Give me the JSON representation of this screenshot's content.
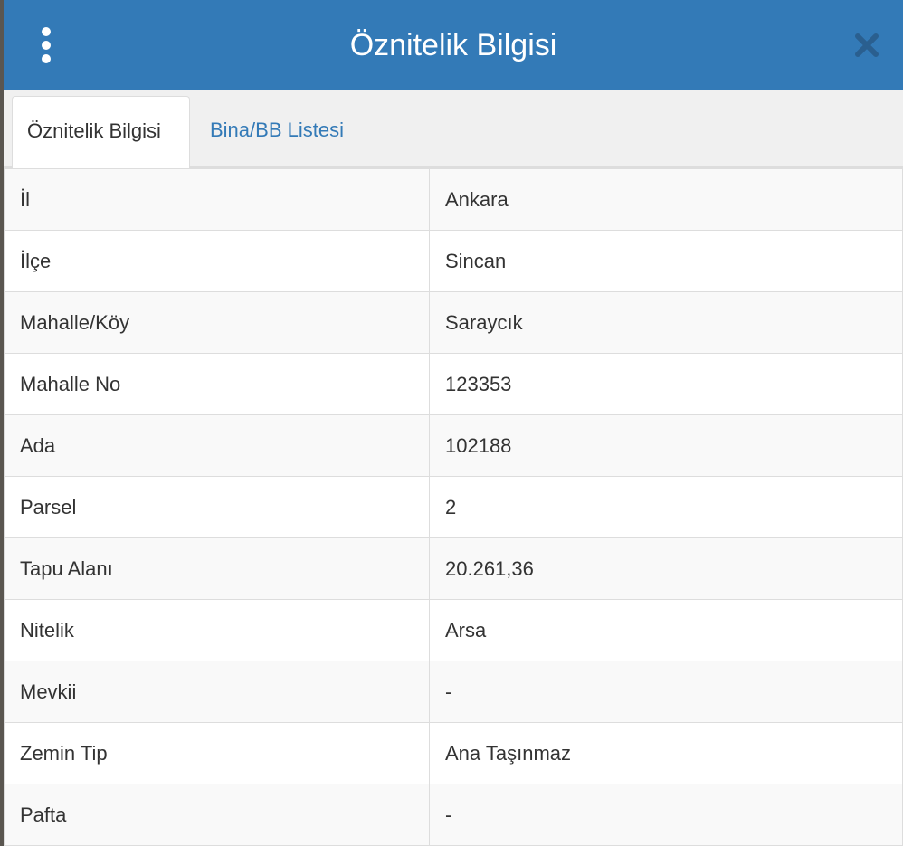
{
  "header": {
    "title": "Öznitelik Bilgisi",
    "menu_icon": "vertical-ellipsis-icon",
    "close_icon": "close-icon"
  },
  "tabs": [
    {
      "label": "Öznitelik Bilgisi",
      "active": true
    },
    {
      "label": "Bina/BB Listesi",
      "active": false
    }
  ],
  "attributes": [
    {
      "key": "İl",
      "value": "Ankara"
    },
    {
      "key": "İlçe",
      "value": "Sincan"
    },
    {
      "key": "Mahalle/Köy",
      "value": "Saraycık"
    },
    {
      "key": "Mahalle No",
      "value": "123353"
    },
    {
      "key": "Ada",
      "value": "102188"
    },
    {
      "key": "Parsel",
      "value": "2"
    },
    {
      "key": "Tapu Alanı",
      "value": "20.261,36"
    },
    {
      "key": "Nitelik",
      "value": "Arsa"
    },
    {
      "key": "Mevkii",
      "value": "-"
    },
    {
      "key": "Zemin Tip",
      "value": "Ana Taşınmaz"
    },
    {
      "key": "Pafta",
      "value": "-"
    }
  ],
  "colors": {
    "header_bg": "#337ab7",
    "link": "#337ab7",
    "text": "#333333",
    "close_icon": "#2a5f8f"
  }
}
